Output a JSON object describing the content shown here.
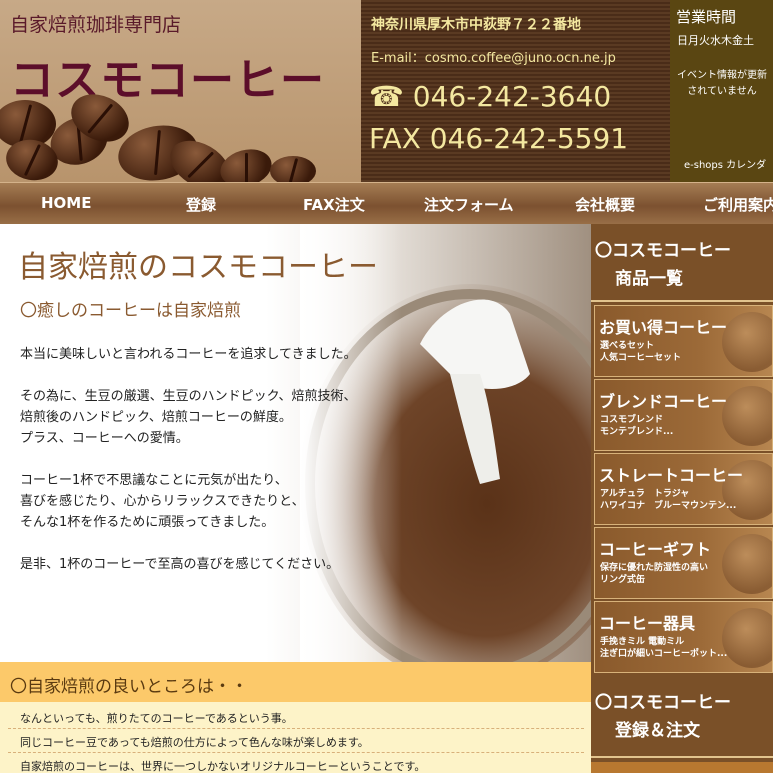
{
  "header": {
    "shop_type": "自家焙煎珈琲専門店",
    "shop_name": "コスモコーヒー",
    "address": "神奈川県厚木市中荻野７２２番地",
    "email": "E-mail：cosmo.coffee@juno.ocn.ne.jp",
    "tel": "☎ 046-242-3640",
    "fax": "FAX 046-242-5591",
    "hours_title": "営業時間",
    "hours_days": "日月火水木金土",
    "event_note": "イベント情報が更新されていません",
    "eshop_link": "e-shops カレンダ"
  },
  "nav": {
    "items": [
      "HOME",
      "登録",
      "FAX注文",
      "注文フォーム",
      "会社概要",
      "ご利用案内"
    ]
  },
  "main": {
    "title": "自家焙煎のコスモコーヒー",
    "subtitle": "〇癒しのコーヒーは自家焙煎",
    "paragraphs": [
      "本当に美味しいと言われるコーヒーを追求してきました。",
      "その為に、生豆の厳選、生豆のハンドピック、焙煎技術、\n焙煎後のハンドピック、焙煎コーヒーの鮮度。\nプラス、コーヒーへの愛情。",
      "コーヒー1杯で不思議なことに元気が出たり、\n喜びを感じたり、心からリラックスできたりと、\nそんな1杯を作るために頑張ってきました。",
      "是非、1杯のコーヒーで至高の喜びを感じてください。"
    ]
  },
  "good_points": {
    "title": "〇自家焙煎の良いところは・・",
    "lines": [
      "なんといっても、煎りたてのコーヒーであるという事。",
      "同じコーヒー豆であっても焙煎の仕方によって色んな味が楽しめます。",
      "自家焙煎のコーヒーは、世界に一つしかないオリジナルコーヒーということです。"
    ]
  },
  "sidebar": {
    "products_head_1": "〇コスモコーヒー",
    "products_head_2": "商品一覧",
    "cards": [
      {
        "title": "お買い得コーヒー",
        "sub": "選べるセット\n人気コーヒーセット"
      },
      {
        "title": "ブレンドコーヒー",
        "sub": "コスモブレンド\nモンテブレンド..."
      },
      {
        "title": "ストレートコーヒー",
        "sub": "アルチュラ　トラジャ\nハワイコナ　ブルーマウンテン..."
      },
      {
        "title": "コーヒーギフト",
        "sub": "保存に優れた防湿性の高い\nリング式缶"
      },
      {
        "title": "コーヒー器具",
        "sub": "手挽きミル 電動ミル\n注ぎ口が細いコーヒーポット..."
      }
    ],
    "register_head_1": "〇コスモコーヒー",
    "register_head_2": "登録＆注文"
  }
}
